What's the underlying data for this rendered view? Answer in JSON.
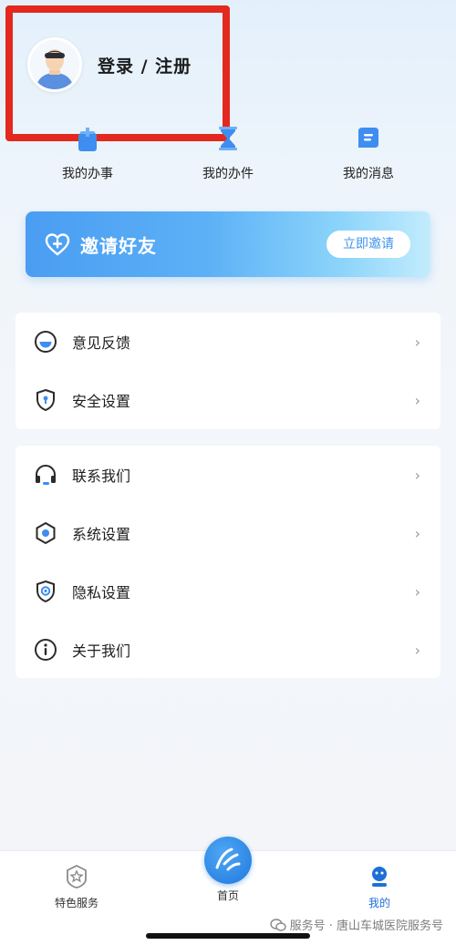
{
  "profile": {
    "login_label": "登录 / 注册"
  },
  "quick_links": [
    {
      "label": "我的办事",
      "icon": "task-icon"
    },
    {
      "label": "我的办件",
      "icon": "hourglass-icon"
    },
    {
      "label": "我的消息",
      "icon": "message-icon"
    }
  ],
  "invite": {
    "title": "邀请好友",
    "button_label": "立即邀请",
    "icon": "heart-plus-icon"
  },
  "menu_group1": [
    {
      "label": "意见反馈",
      "icon": "feedback-icon"
    },
    {
      "label": "安全设置",
      "icon": "shield-lock-icon"
    }
  ],
  "menu_group2": [
    {
      "label": "联系我们",
      "icon": "headset-icon"
    },
    {
      "label": "系统设置",
      "icon": "settings-hex-icon"
    },
    {
      "label": "隐私设置",
      "icon": "privacy-shield-icon"
    },
    {
      "label": "关于我们",
      "icon": "info-icon"
    }
  ],
  "chevron": "›",
  "tabbar": {
    "tabs": [
      {
        "label": "特色服务",
        "icon": "badge-star-icon"
      },
      {
        "label": "首页",
        "icon": "home-logo-icon"
      },
      {
        "label": "我的",
        "icon": "profile-robot-icon"
      }
    ]
  },
  "watermark": {
    "text": "服务号 · 唐山车城医院服务号"
  },
  "colors": {
    "accent": "#3f93ec",
    "icon_blue": "#3d8ef0",
    "highlight_red": "#e3281f",
    "active_tab": "#1f6fd8"
  }
}
